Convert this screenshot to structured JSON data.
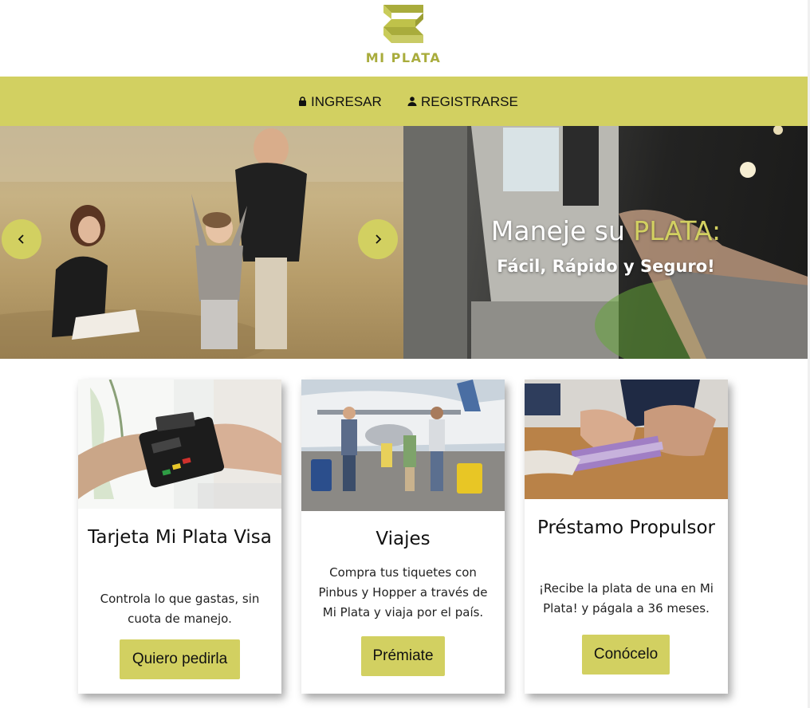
{
  "brand": {
    "name": "MI PLATA",
    "accent_color": "#d2d061",
    "logo_color": "#a9ac3c"
  },
  "nav": {
    "login": {
      "label": "INGRESAR",
      "icon": "lock-icon"
    },
    "register": {
      "label": "REGISTRARSE",
      "icon": "user-icon"
    }
  },
  "hero": {
    "title_prefix": "Maneje su ",
    "title_accent": "PLATA:",
    "subtitle": "Fácil, Rápido y Seguro!",
    "prev_icon": "chevron-left-icon",
    "next_icon": "chevron-right-icon",
    "left_photo": "family-outdoors-photo",
    "right_photo": "atm-photo"
  },
  "cards": [
    {
      "title": "Tarjeta Mi Plata Visa",
      "text": "Controla lo que gastas, sin cuota de manejo.",
      "button": "Quiero pedirla",
      "photo": "card-payment-terminal-photo"
    },
    {
      "title": "Viajes",
      "text": "Compra tus tiquetes con Pinbus y Hopper a través de Mi Plata y viaja por el país.",
      "button": "Prémiate",
      "photo": "family-airport-photo"
    },
    {
      "title": "Préstamo Propulsor",
      "text": "¡Recibe la plata de una en Mi Plata! y págala a 36 meses.",
      "button": "Conócelo",
      "photo": "money-handover-photo"
    }
  ]
}
